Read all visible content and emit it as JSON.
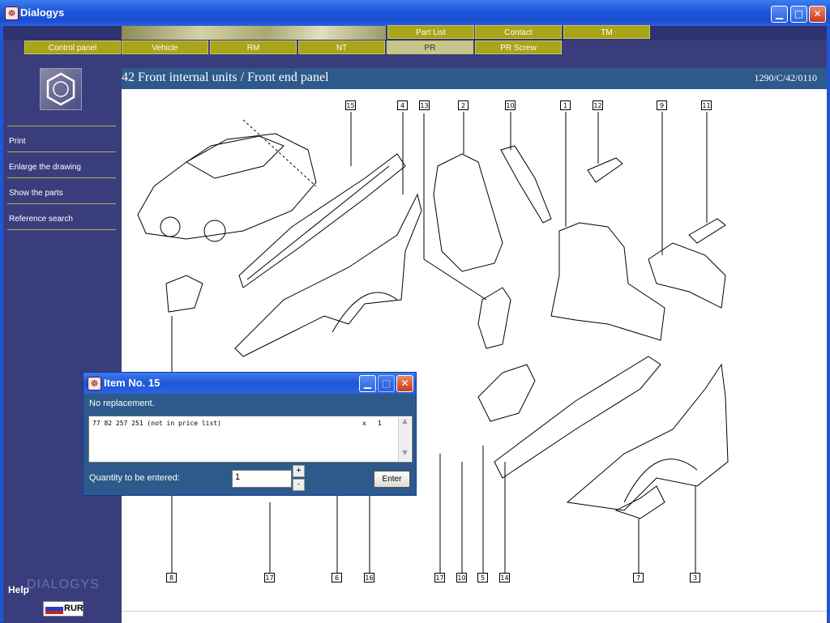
{
  "window": {
    "title": "Dialogys"
  },
  "tabs_row1": [
    "Part List",
    "Contact",
    "TM"
  ],
  "tabs_row2": [
    "Control panel",
    "Vehicle",
    "RM",
    "NT",
    "PR",
    "PR Screw"
  ],
  "active_tab": "PR",
  "sidebar": {
    "menu": [
      "Print",
      "Enlarge the drawing",
      "Show the parts",
      "Reference search"
    ],
    "help": "Help",
    "brand": "DIALOGYS",
    "currency": "RUR"
  },
  "header": {
    "title": "42 Front internal units / Front end panel",
    "ref": "1290/C/42/0110"
  },
  "callouts_top": [
    "15",
    "4",
    "13",
    "2",
    "10",
    "1",
    "12",
    "9",
    "11"
  ],
  "callouts_bottom": [
    "8",
    "17",
    "6",
    "16",
    "17",
    "10",
    "5",
    "14",
    "7",
    "3"
  ],
  "dialog": {
    "title": "Item No. 15",
    "message": "No replacement.",
    "part_line": "77 82 257 251 (not in price list)",
    "qty_x": "x",
    "qty_n": "1",
    "qty_label": "Quantity to be entered:",
    "qty_value": "1",
    "plus": "+",
    "minus": "-",
    "enter": "Enter"
  }
}
